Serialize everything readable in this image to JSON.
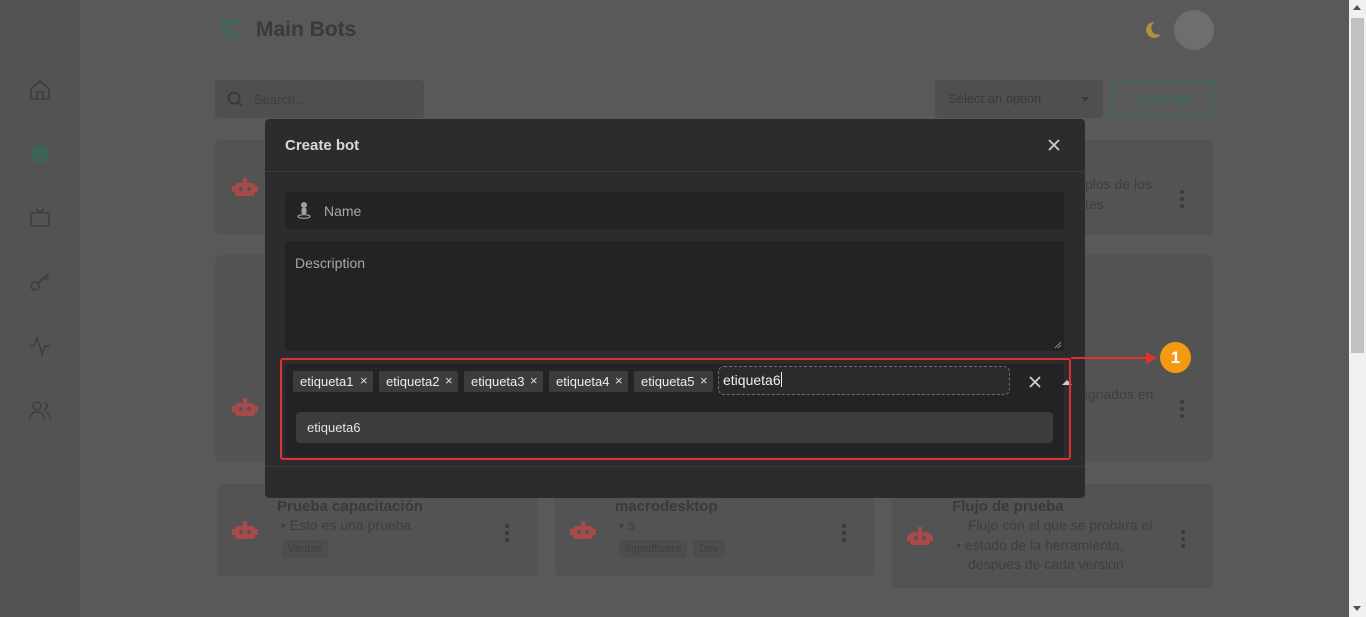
{
  "header": {
    "title": "Main Bots"
  },
  "toolbar": {
    "search_placeholder": "Search...",
    "select_placeholder": "Select an option",
    "create_label": "Crear bot"
  },
  "sidebar": {
    "items": [
      {
        "name": "home-icon"
      },
      {
        "name": "chip-icon",
        "active": true
      },
      {
        "name": "tv-icon"
      },
      {
        "name": "key-icon"
      },
      {
        "name": "activity-icon"
      },
      {
        "name": "users-icon"
      }
    ]
  },
  "cards": [
    {
      "title": "",
      "text_lines": [
        "plos de los",
        "tes"
      ],
      "tags": []
    },
    {
      "title": "",
      "text_lines": [
        "asignados en"
      ],
      "tags": []
    },
    {
      "title": "Prueba capacitación",
      "text_lines": [
        "• Esto es una prueba"
      ],
      "tags": [
        "Ventas"
      ]
    },
    {
      "title": "macrodesktop",
      "text_lines": [
        "• s"
      ],
      "tags": [
        "ingsoftware",
        "Dev"
      ]
    },
    {
      "title": "Flujo de prueba",
      "text_lines": [
        "Flujo con el que se probara el",
        "• estado de la herramienta,",
        "después de cada versión"
      ],
      "tags": []
    }
  ],
  "modal": {
    "title": "Create bot",
    "name_placeholder": "Name",
    "description_placeholder": "Description",
    "tags": [
      "etiqueta1",
      "etiqueta2",
      "etiqueta3",
      "etiqueta4",
      "etiqueta5"
    ],
    "tag_input_value": "etiqueta6",
    "dropdown_option": "etiqueta6"
  },
  "annotation": {
    "step_number": "1",
    "color": "#e03131",
    "badge_color": "#f39a10"
  },
  "colors": {
    "accent": "#2e6f5a",
    "robot": "#a84a4a",
    "moon": "#b09040"
  }
}
